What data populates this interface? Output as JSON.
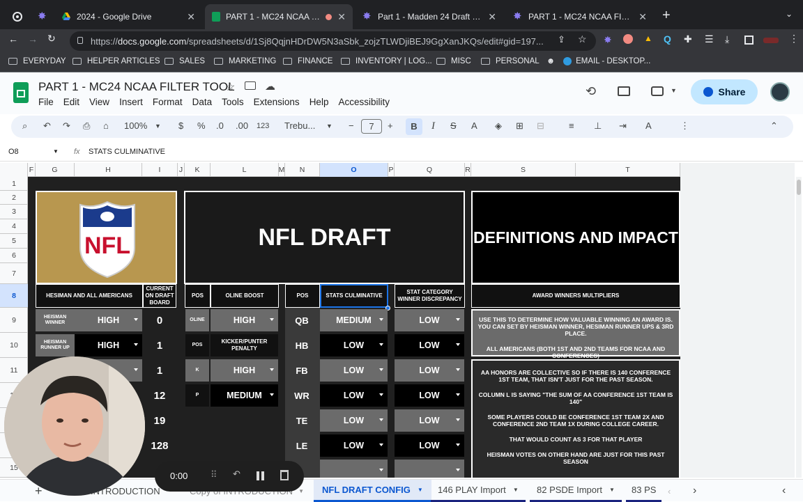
{
  "browser": {
    "tabs": [
      {
        "label": "",
        "icon": "record-icon"
      },
      {
        "label": "",
        "icon": "madden-icon"
      },
      {
        "label": "2024 - Google Drive",
        "icon": "drive-icon"
      },
      {
        "label": "PART 1 - MC24 NCAA FILT",
        "icon": "sheets-icon",
        "active": true
      },
      {
        "label": "Part 1 - Madden 24 Draft Class",
        "icon": "madden-icon"
      },
      {
        "label": "PART 1 - MC24 NCAA FILTER T",
        "icon": "madden-icon"
      }
    ],
    "url_prefix": "https://",
    "url_host": "docs.google.com",
    "url_rest": "/spreadsheets/d/1Sj8QqjnHDrDW5N3aSbk_zojzTLWDjiBEJ9GgXanJKQs/edit#gid=197...",
    "bookmarks": [
      "EVERYDAY",
      "HELPER ARTICLES",
      "SALES",
      "MARKETING",
      "FINANCE",
      "INVENTORY | LOG...",
      "MISC",
      "PERSONAL",
      "EMAIL - DESKTOP..."
    ]
  },
  "app": {
    "title": "PART 1 - MC24 NCAA FILTER TOOL",
    "menu": [
      "File",
      "Edit",
      "View",
      "Insert",
      "Format",
      "Data",
      "Tools",
      "Extensions",
      "Help",
      "Accessibility"
    ],
    "share_label": "Share",
    "toolbar": {
      "zoom": "100%",
      "currency": "$",
      "percent": "%",
      "dec_dec": ".0",
      "dec_inc": ".00",
      "fmt": "123",
      "font": "Trebu...",
      "font_size": "7",
      "bold": "B",
      "italic": "I"
    },
    "cell_ref": "O8",
    "formula": "STATS CULMINATIVE"
  },
  "grid": {
    "columns": [
      "F",
      "G",
      "H",
      "I",
      "J",
      "K",
      "L",
      "M",
      "N",
      "O",
      "P",
      "Q",
      "R",
      "S",
      "T"
    ],
    "rows": [
      "1",
      "2",
      "3",
      "4",
      "5",
      "6",
      "7",
      "8",
      "9",
      "10",
      "11",
      "12",
      "13",
      "14",
      "15"
    ],
    "selected_col": "O",
    "selected_row": "8"
  },
  "sheet": {
    "nfl_draft_title": "NFL DRAFT",
    "definitions_title": "DEFINITIONS AND IMPACT",
    "hdr_heisman": "HESIMAN AND ALL AMERICANS",
    "hdr_current": "CURRENT ON DRAFT BOARD",
    "hdr_pos": "POS",
    "hdr_oline": "OLINE BOOST",
    "hdr_pos2": "POS",
    "hdr_stats": "STATS CULMINATIVE",
    "hdr_statcat": "STAT CATEGORY WINNER DISCREPANCY",
    "hdr_award": "AWARD WINNERS MULTIPLIERS",
    "heisman_winner_label": "HEISMAN WINNER",
    "heisman_winner_value": "HIGH",
    "heisman_runner_label": "HEISMAN RUNNER UP",
    "heisman_runner_value": "HIGH",
    "current_board": [
      "0",
      "1",
      "1",
      "12",
      "19",
      "128"
    ],
    "oline_label": "OLINE",
    "oline_value": "HIGH",
    "pos_label": "POS",
    "kicker_header": "KICKER/PUNTER PENALTY",
    "k_label": "K",
    "k_value": "HIGH",
    "p_label": "P",
    "p_value": "MEDIUM",
    "positions": [
      "QB",
      "HB",
      "FB",
      "WR",
      "TE",
      "LE"
    ],
    "stats_values": [
      "MEDIUM",
      "LOW",
      "LOW",
      "LOW",
      "LOW",
      "LOW"
    ],
    "statcat_values": [
      "LOW",
      "LOW",
      "LOW",
      "LOW",
      "LOW",
      "LOW"
    ],
    "def_box1": [
      "USE THIS TO DETERMINE HOW VALUABLE WINNING AN AWARD IS. YOU CAN SET BY HEISMAN WINNER, HESIMAN RUNNER UPS & 3RD PLACE.",
      "ALL AMERICANS (BOTH 1ST AND 2ND TEAMS FOR NCAA AND CONFERENCES)"
    ],
    "def_box2": [
      "AA HONORS ARE COLLECTIVE SO IF THERE IS 140 CONFERENCE 1ST TEAM, THAT ISN'T JUST FOR THE PAST SEASON.",
      "COLUMN L IS SAYING \"THE SUM OF AA CONFERENCE 1ST TEAM IS 140\"",
      "SOME PLAYERS COULD BE CONFERENCE 1ST TEAM 2X AND CONFERENCE 2ND TEAM 1X DURING COLLEGE CAREER.",
      "THAT WOULD COUNT AS 3 FOR THAT PLAYER",
      "HEISMAN VOTES ON OTHER HAND ARE JUST FOR THIS PAST SEASON"
    ]
  },
  "sheet_tabs": [
    "INTRODUCTION",
    "Copy of INTRODUCTION",
    "NFL DRAFT CONFIG",
    "146 PLAY Import",
    "82 PSDE Import",
    "83 PS"
  ],
  "recorder": {
    "time": "0:00"
  }
}
